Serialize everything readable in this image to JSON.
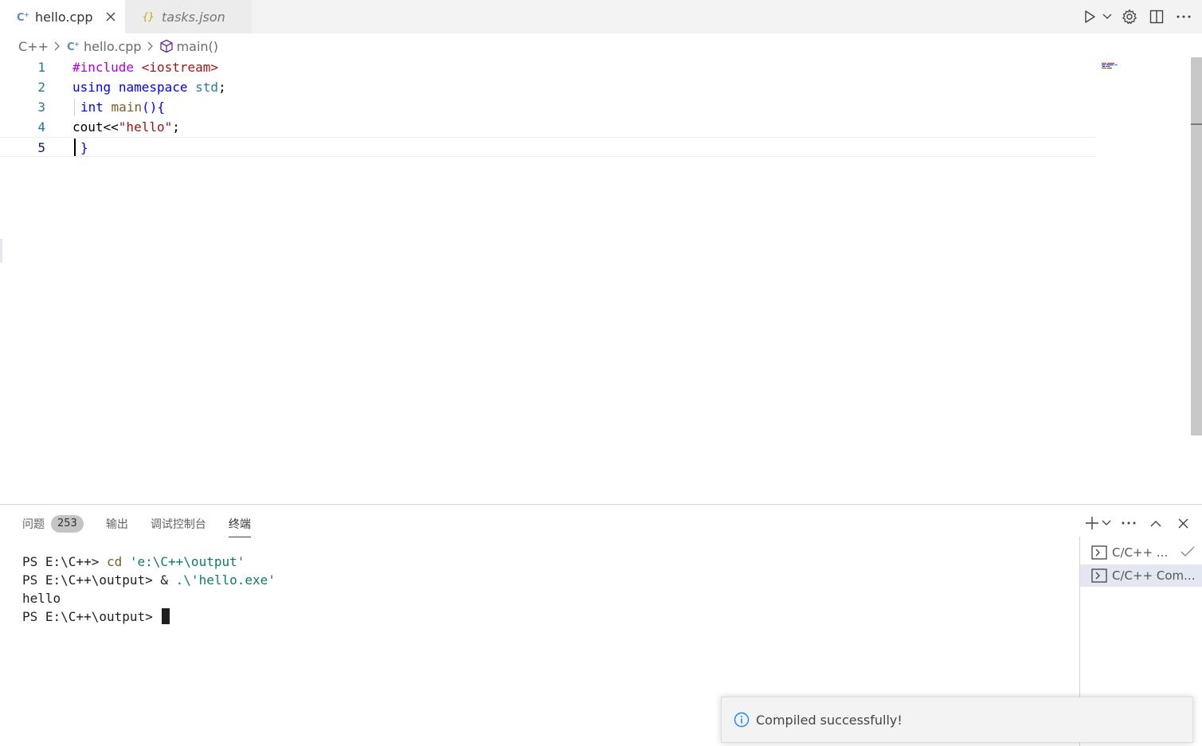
{
  "colors": {
    "accent": "#0b216f",
    "cpp_icon": "#5c8bc0",
    "json_icon": "#c4a000",
    "info_icon": "#1a85ff"
  },
  "tabs": [
    {
      "label": "hello.cpp",
      "icon": "cpp-file-icon",
      "active": true
    },
    {
      "label": "tasks.json",
      "icon": "json-file-icon",
      "active": false
    }
  ],
  "breadcrumb": {
    "folder": "C++",
    "file": "hello.cpp",
    "symbol": "main()"
  },
  "editor": {
    "lines": [
      {
        "num": "1",
        "tokens": {
          "pre": "#include",
          "inc": " <iostream>"
        }
      },
      {
        "num": "2",
        "tokens": {
          "kw1": "using",
          "kw2": "namespace",
          "ns": "std",
          "end": ";"
        }
      },
      {
        "num": "3",
        "tokens": {
          "kw": "int",
          "fn": "main",
          "end": "(){"
        }
      },
      {
        "num": "4",
        "tokens": {
          "a": "cout<<",
          "str": "\"hello\"",
          "end": ";"
        }
      },
      {
        "num": "5",
        "tokens": {
          "brace": "}"
        }
      }
    ]
  },
  "panel": {
    "tabs": {
      "problems": "问题",
      "problems_count": "253",
      "output": "输出",
      "debug_console": "调试控制台",
      "terminal": "终端"
    },
    "terminal_lines": [
      {
        "prompt": "PS E:\\C++> ",
        "cmd": "cd",
        "arg": " 'e:\\C++\\output'"
      },
      {
        "prompt": "PS E:\\C++\\output> ",
        "cmd": "&",
        "arg": " .\\'hello.exe'"
      },
      {
        "out": "hello"
      },
      {
        "prompt": "PS E:\\C++\\output> "
      }
    ],
    "terminal_list": [
      {
        "label": "C/C++ ...",
        "selected": false
      },
      {
        "label": "C/C++ Com...",
        "selected": true
      }
    ]
  },
  "toast": {
    "message": "Compiled successfully!"
  }
}
